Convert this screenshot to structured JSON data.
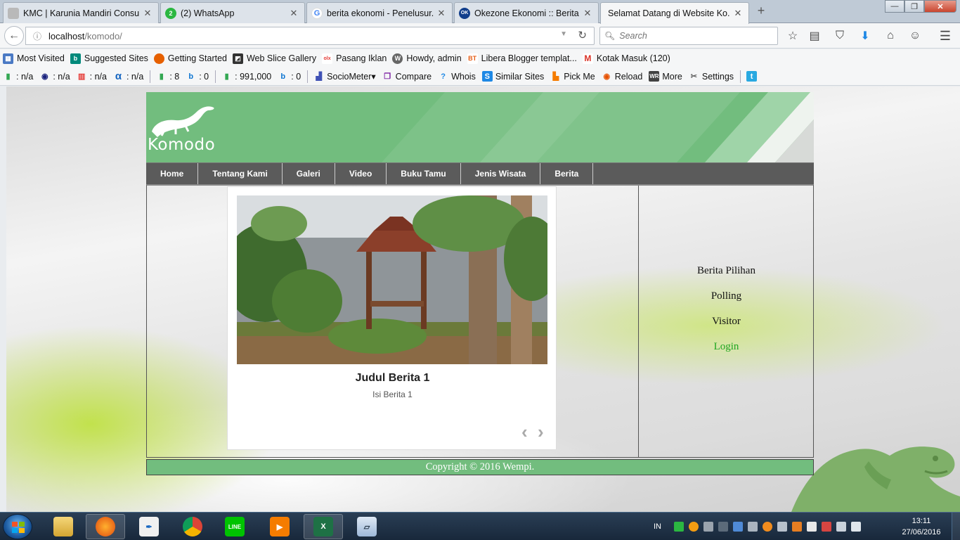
{
  "browser": {
    "tabs": [
      {
        "title": "KMC | Karunia Mandiri Consult...",
        "icon": "kmc-icon",
        "color": "#b0b0b0"
      },
      {
        "title": "(2) WhatsApp",
        "icon": "whatsapp-icon",
        "color": "#2bb741",
        "badge": "2"
      },
      {
        "title": "berita ekonomi - Penelusur...",
        "icon": "google-icon",
        "color": "#4285f4"
      },
      {
        "title": "Okezone Ekonomi :: Berita ...",
        "icon": "okezone-icon",
        "color": "#123f8c",
        "badge": "OK"
      },
      {
        "title": "Selamat Datang di Website Ko...",
        "icon": "page-icon",
        "color": "#f5f6f7",
        "active": true
      }
    ],
    "url": {
      "host": "localhost",
      "path": "/komodo/"
    },
    "search_placeholder": "Search",
    "bookmarks": [
      {
        "label": "Most Visited",
        "icon": "most-visited-icon",
        "color": "#4a79c4"
      },
      {
        "label": "Suggested Sites",
        "icon": "bing-icon",
        "color": "#00897b"
      },
      {
        "label": "Getting Started",
        "icon": "firefox-icon",
        "color": "#e66000"
      },
      {
        "label": "Web Slice Gallery",
        "icon": "webslice-icon",
        "color": "#333333"
      },
      {
        "label": "Pasang Iklan",
        "icon": "olx-icon",
        "color": "#f4c430"
      },
      {
        "label": "Howdy, admin",
        "icon": "wordpress-icon",
        "color": "#666666"
      },
      {
        "label": "Libera Blogger templat...",
        "icon": "bt-icon",
        "color": "#e55b13"
      },
      {
        "label": "Kotak Masuk (120)",
        "icon": "gmail-icon",
        "color": "#d93025"
      }
    ],
    "seo_toolbar": [
      {
        "label": ": n/a",
        "icon": "google-pagerank-icon",
        "color": "#34a853"
      },
      {
        "label": ": n/a",
        "icon": "dmoz-icon",
        "color": "#1a237e"
      },
      {
        "label": ": n/a",
        "icon": "stats-icon",
        "color": "#e53935"
      },
      {
        "label": ": n/a",
        "icon": "alexa-icon",
        "color": "#1565c0"
      },
      {
        "label": ": 8",
        "icon": "google-index-icon",
        "color": "#34a853"
      },
      {
        "label": ": 0",
        "icon": "bing-index-icon",
        "color": "#0b74d1"
      },
      {
        "label": ": 991,000",
        "icon": "google-backlinks-icon",
        "color": "#34a853"
      },
      {
        "label": ": 0",
        "icon": "bing-backlinks-icon",
        "color": "#0b74d1"
      },
      {
        "label": "SocioMeter▾",
        "icon": "sociometer-icon",
        "color": "#3f51b5"
      },
      {
        "label": "Compare",
        "icon": "compare-icon",
        "color": "#7b1fa2"
      },
      {
        "label": "Whois",
        "icon": "whois-icon",
        "color": "#1e88e5"
      },
      {
        "label": "Similar Sites",
        "icon": "similar-sites-icon",
        "color": "#1e88e5"
      },
      {
        "label": "Pick Me",
        "icon": "pick-me-icon",
        "color": "#f57c00"
      },
      {
        "label": "Reload",
        "icon": "reload-icon",
        "color": "#e65100"
      },
      {
        "label": "More",
        "icon": "more-icon",
        "color": "#424242"
      },
      {
        "label": "Settings",
        "icon": "settings-icon",
        "color": "#616161"
      }
    ]
  },
  "site": {
    "logo_text": "Komodo",
    "menu": [
      "Home",
      "Tentang Kami",
      "Galeri",
      "Video",
      "Buku Tamu",
      "Jenis Wisata",
      "Berita"
    ],
    "slide": {
      "title": "Judul Berita 1",
      "body": "Isi Berita 1"
    },
    "sidebar": [
      "Berita Pilihan",
      "Polling",
      "Visitor",
      "Login"
    ],
    "footer": "Copyright © 2016 Wempi.",
    "colors": {
      "brand_green": "#72bd7e",
      "menu_gray": "#5b5b5b",
      "login_green": "#1ea61e"
    }
  },
  "taskbar": {
    "apps": [
      "explorer",
      "firefox",
      "inkscape",
      "chrome",
      "line",
      "media-player",
      "excel",
      "notepad"
    ],
    "lang": "IN",
    "time": "13:11",
    "date": "27/06/2016"
  }
}
